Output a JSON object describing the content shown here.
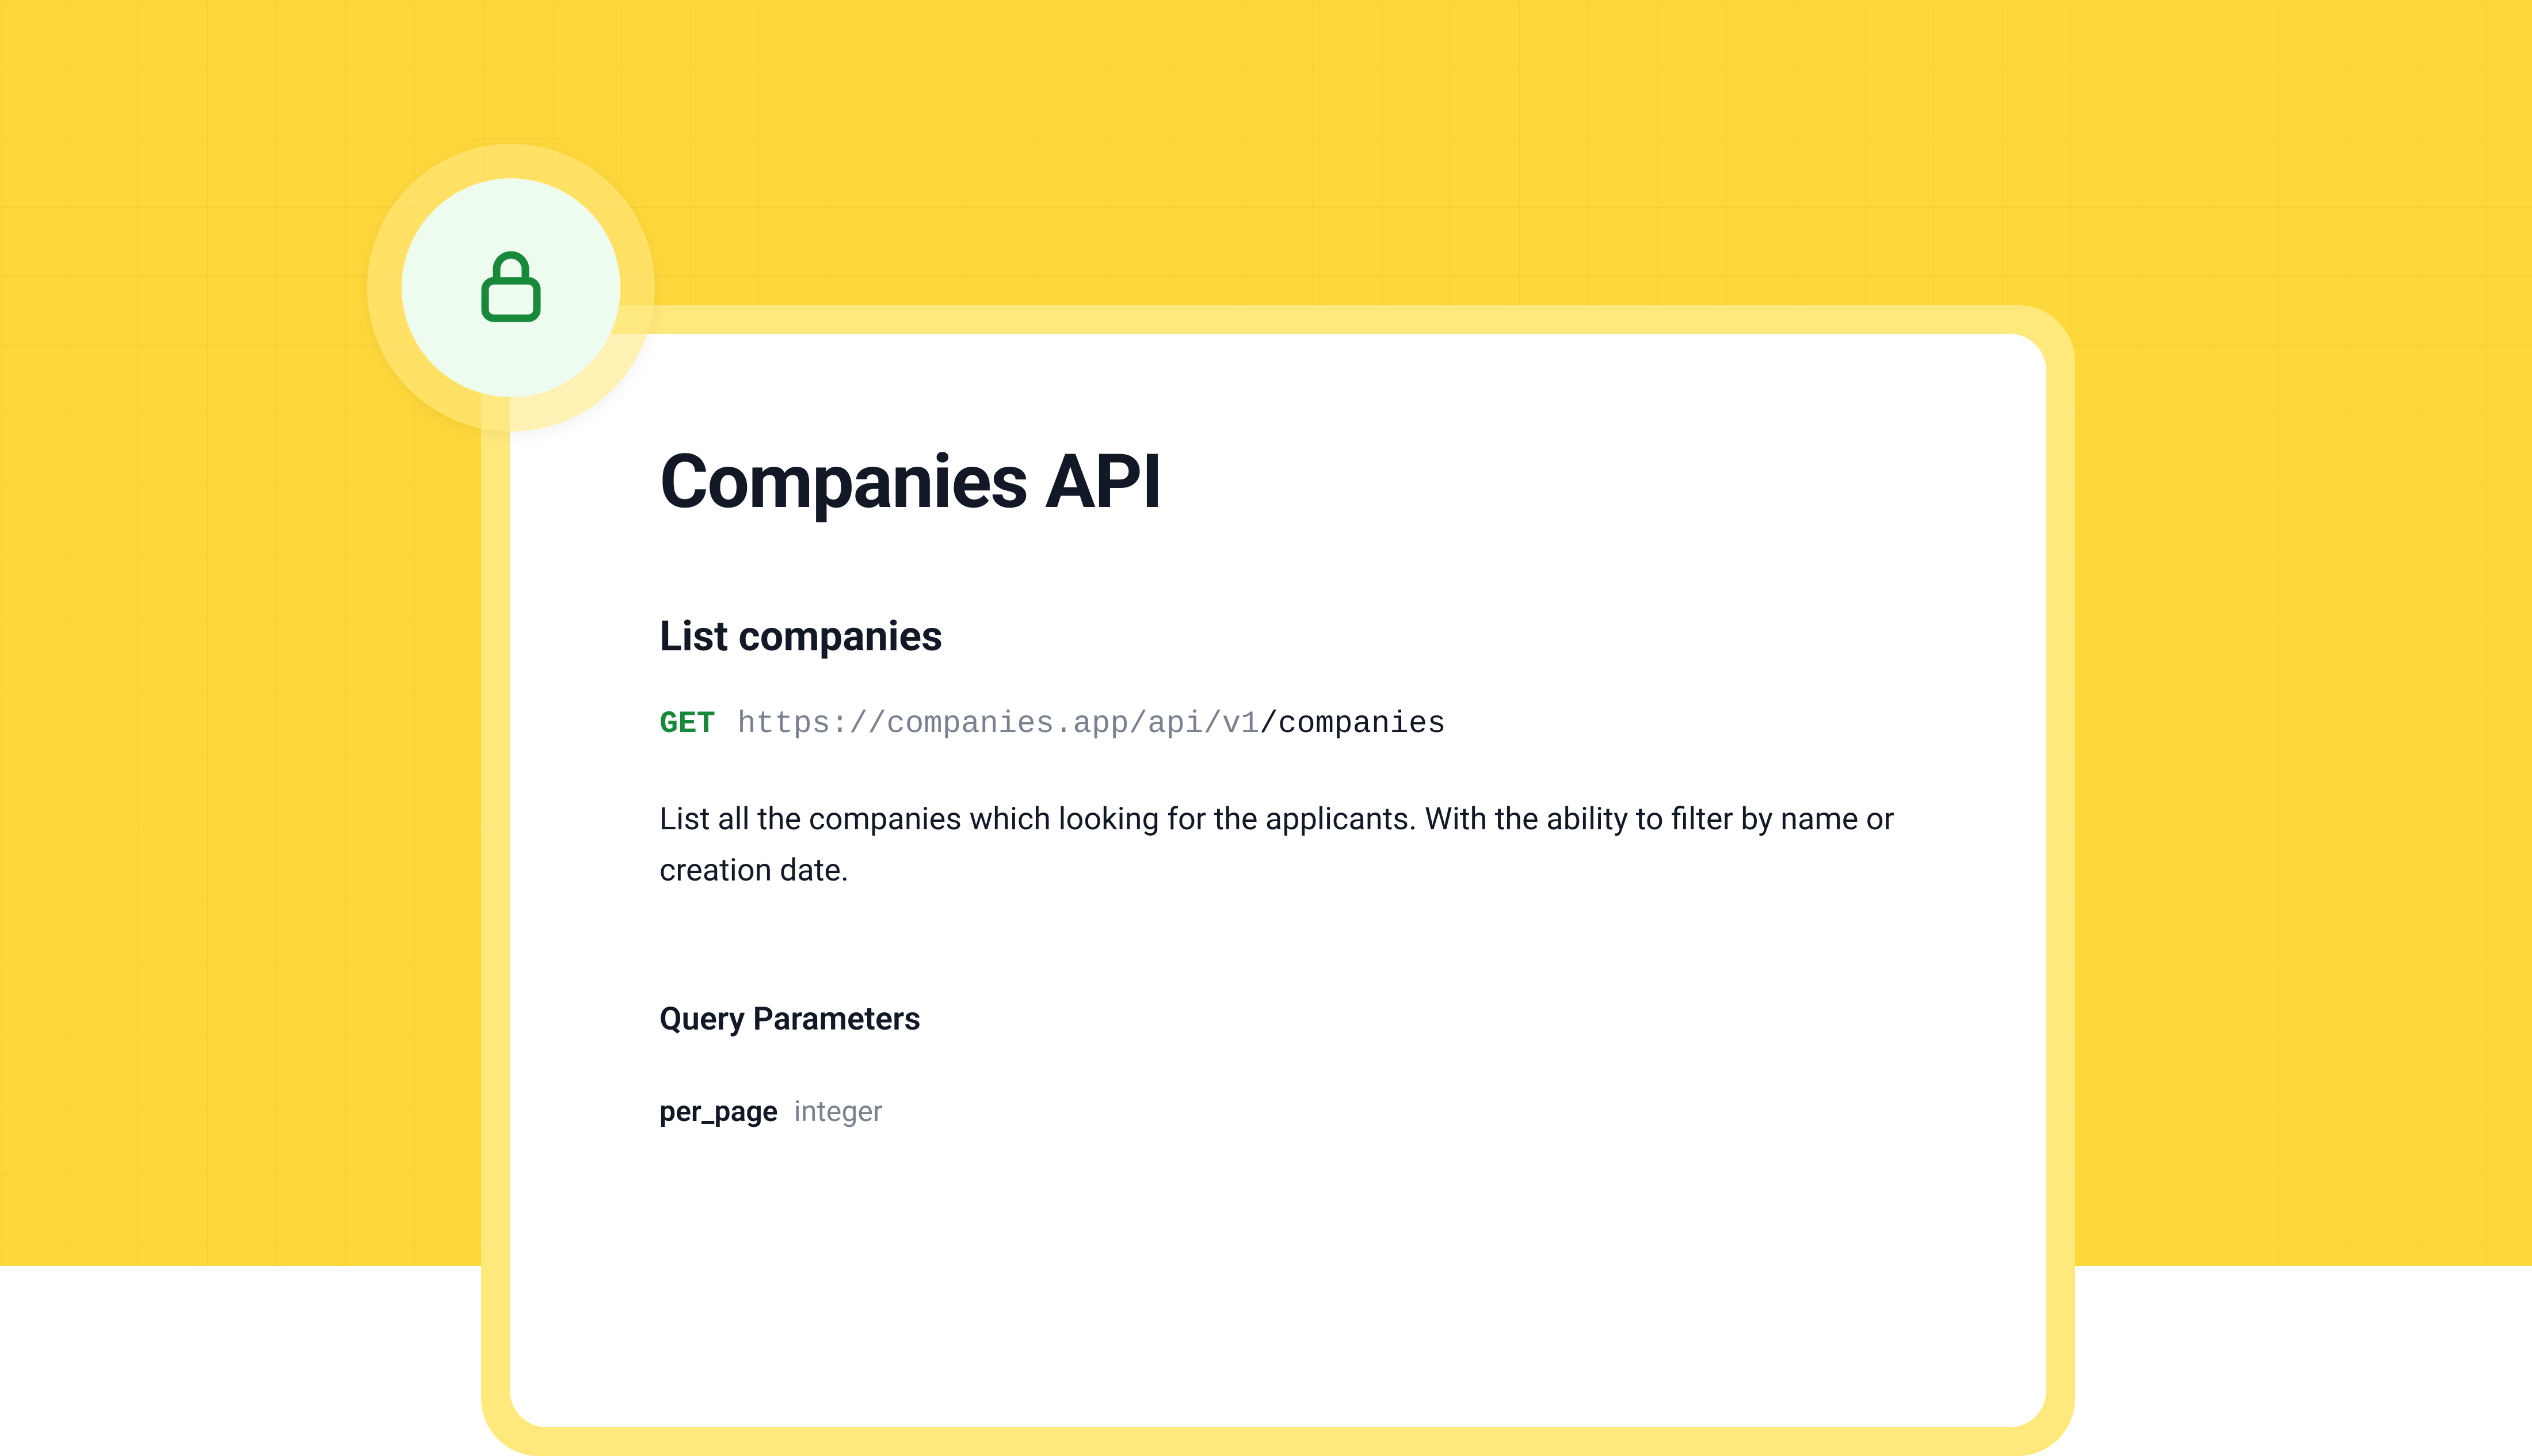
{
  "page": {
    "title": "Companies API"
  },
  "endpoint": {
    "section_title": "List companies",
    "method": "GET",
    "url_base": "https://companies.app/api/v1",
    "url_path": "/companies",
    "description": "List all the companies which looking for the applicants. With the ability to filter by name or creation date."
  },
  "query_params": {
    "heading": "Query Parameters",
    "items": [
      {
        "name": "per_page",
        "type": "integer"
      }
    ]
  },
  "colors": {
    "accent_yellow": "#FED83B",
    "accent_green": "#18893B"
  }
}
